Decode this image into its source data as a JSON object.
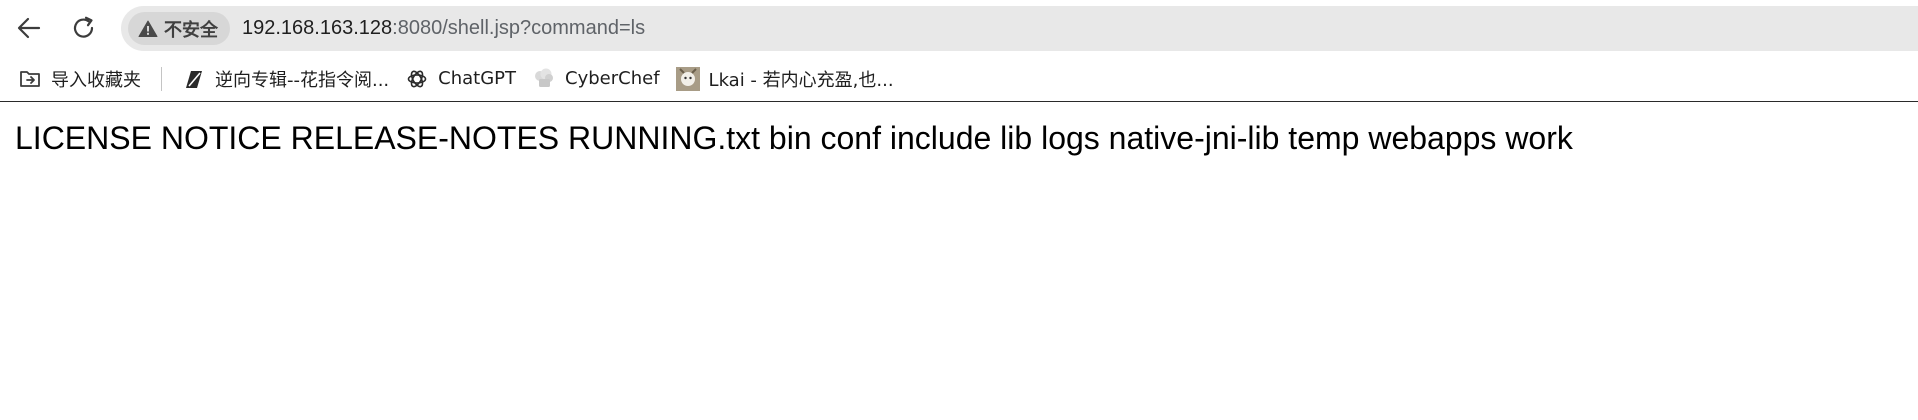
{
  "address_bar": {
    "security_label": "不安全",
    "url_host": "192.168.163.128",
    "url_rest": ":8080/shell.jsp?command=ls"
  },
  "bookmarks": {
    "import_label": "导入收藏夹",
    "items": [
      {
        "label": "逆向专辑--花指令阅...",
        "icon": "feather-icon"
      },
      {
        "label": "ChatGPT",
        "icon": "chatgpt-icon"
      },
      {
        "label": "CyberChef",
        "icon": "chef-hat-icon"
      },
      {
        "label": "Lkai - 若内心充盈,也...",
        "icon": "avatar-icon"
      }
    ]
  },
  "page": {
    "output": "LICENSE NOTICE RELEASE-NOTES RUNNING.txt bin conf include lib logs native-jni-lib temp webapps work"
  },
  "colors": {
    "omnibox_bg": "#e8e8e8",
    "chip_bg": "#d7d7d7",
    "text": "#1f1f1f",
    "url_dim": "#5f6368"
  }
}
